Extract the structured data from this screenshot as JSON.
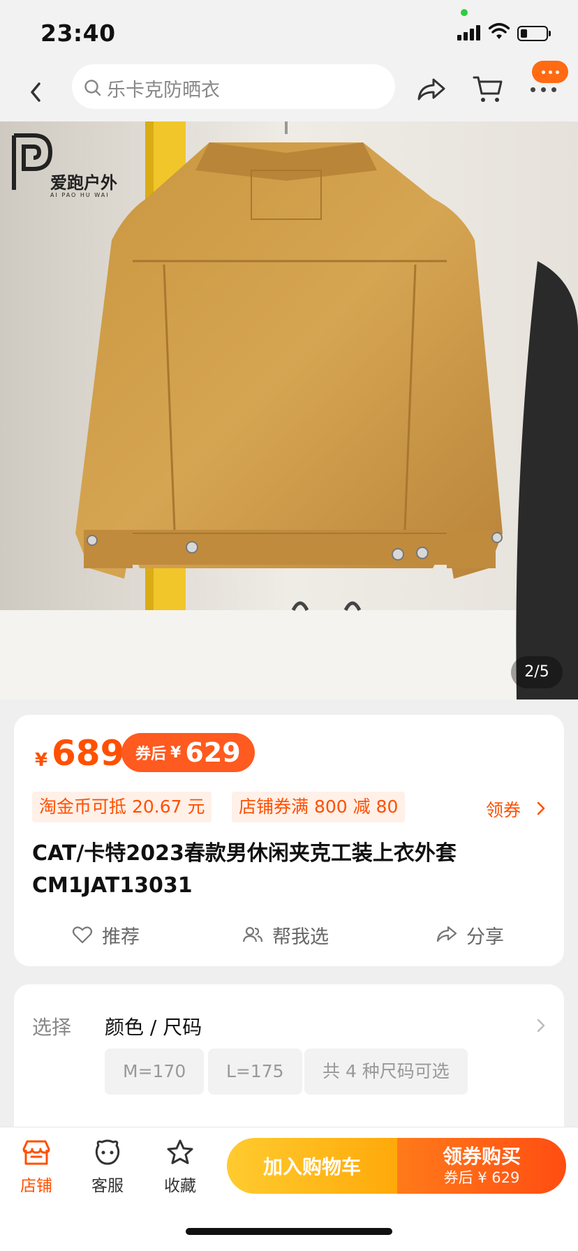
{
  "status_bar": {
    "time": "23:40"
  },
  "nav": {
    "search_text": "乐卡克防晒衣",
    "icons": [
      "back-icon",
      "share-icon",
      "cart-icon",
      "more-icon"
    ],
    "accent_color": "#ff6a13"
  },
  "gallery": {
    "brand_logo_name": "爱跑户外",
    "brand_logo_sub": "AI PAO HU WAI",
    "counter": "2/5"
  },
  "price": {
    "currency": "¥",
    "value": "689",
    "coupon_label": "券后",
    "coupon_currency": "¥",
    "coupon_value": "629",
    "color": "#ff5000"
  },
  "promos": [
    {
      "text": "淘金币可抵 20.67 元"
    },
    {
      "text": "店铺券满 800 减 80"
    }
  ],
  "get_coupon_label": "领券",
  "product": {
    "title_line1": "CAT/卡特2023春款男休闲夹克工装上衣外套",
    "title_line2": "CM1JAT13031"
  },
  "actions": [
    {
      "label": "推荐",
      "icon": "heart-icon"
    },
    {
      "label": "帮我选",
      "icon": "people-icon"
    },
    {
      "label": "分享",
      "icon": "share-icon"
    }
  ],
  "options": {
    "label": "选择",
    "title": "颜色 / 尺码",
    "chips": [
      "M=170",
      "L=175",
      "共 4 种尺码可选"
    ]
  },
  "bottom_bar": {
    "items": [
      {
        "label": "店铺",
        "icon": "shop-icon"
      },
      {
        "label": "客服",
        "icon": "service-icon"
      },
      {
        "label": "收藏",
        "icon": "star-icon"
      }
    ],
    "add_cart": "加入购物车",
    "buy_main": "领券购买",
    "buy_sub": "券后 ¥ 629"
  }
}
